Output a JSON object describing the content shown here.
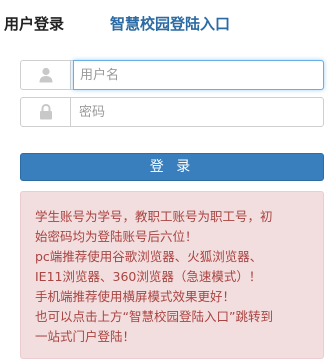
{
  "tabs": {
    "active_label": "用户登录",
    "portal_label": "智慧校园登陆入口"
  },
  "form": {
    "username_placeholder": "用户名",
    "password_placeholder": "密码",
    "login_label": "登 录"
  },
  "icons": {
    "username": "user-icon",
    "password": "lock-icon"
  },
  "notice": {
    "lines": [
      "学生账号为学号，教职工账号为职工号，初",
      "始密码均为登陆账号后六位！",
      "pc端推荐使用谷歌浏览器、火狐浏览器、",
      "IE11浏览器、360浏览器（急速模式）！",
      "手机端推荐使用横屏模式效果更好！",
      "也可以点击上方“智慧校园登陆入口”跳转到",
      "一站式门户登陆！"
    ]
  },
  "colors": {
    "portal_link": "#2c6ba3",
    "button_bg": "#3a7fbd",
    "notice_bg": "#f2dede",
    "notice_text": "#a94442"
  }
}
